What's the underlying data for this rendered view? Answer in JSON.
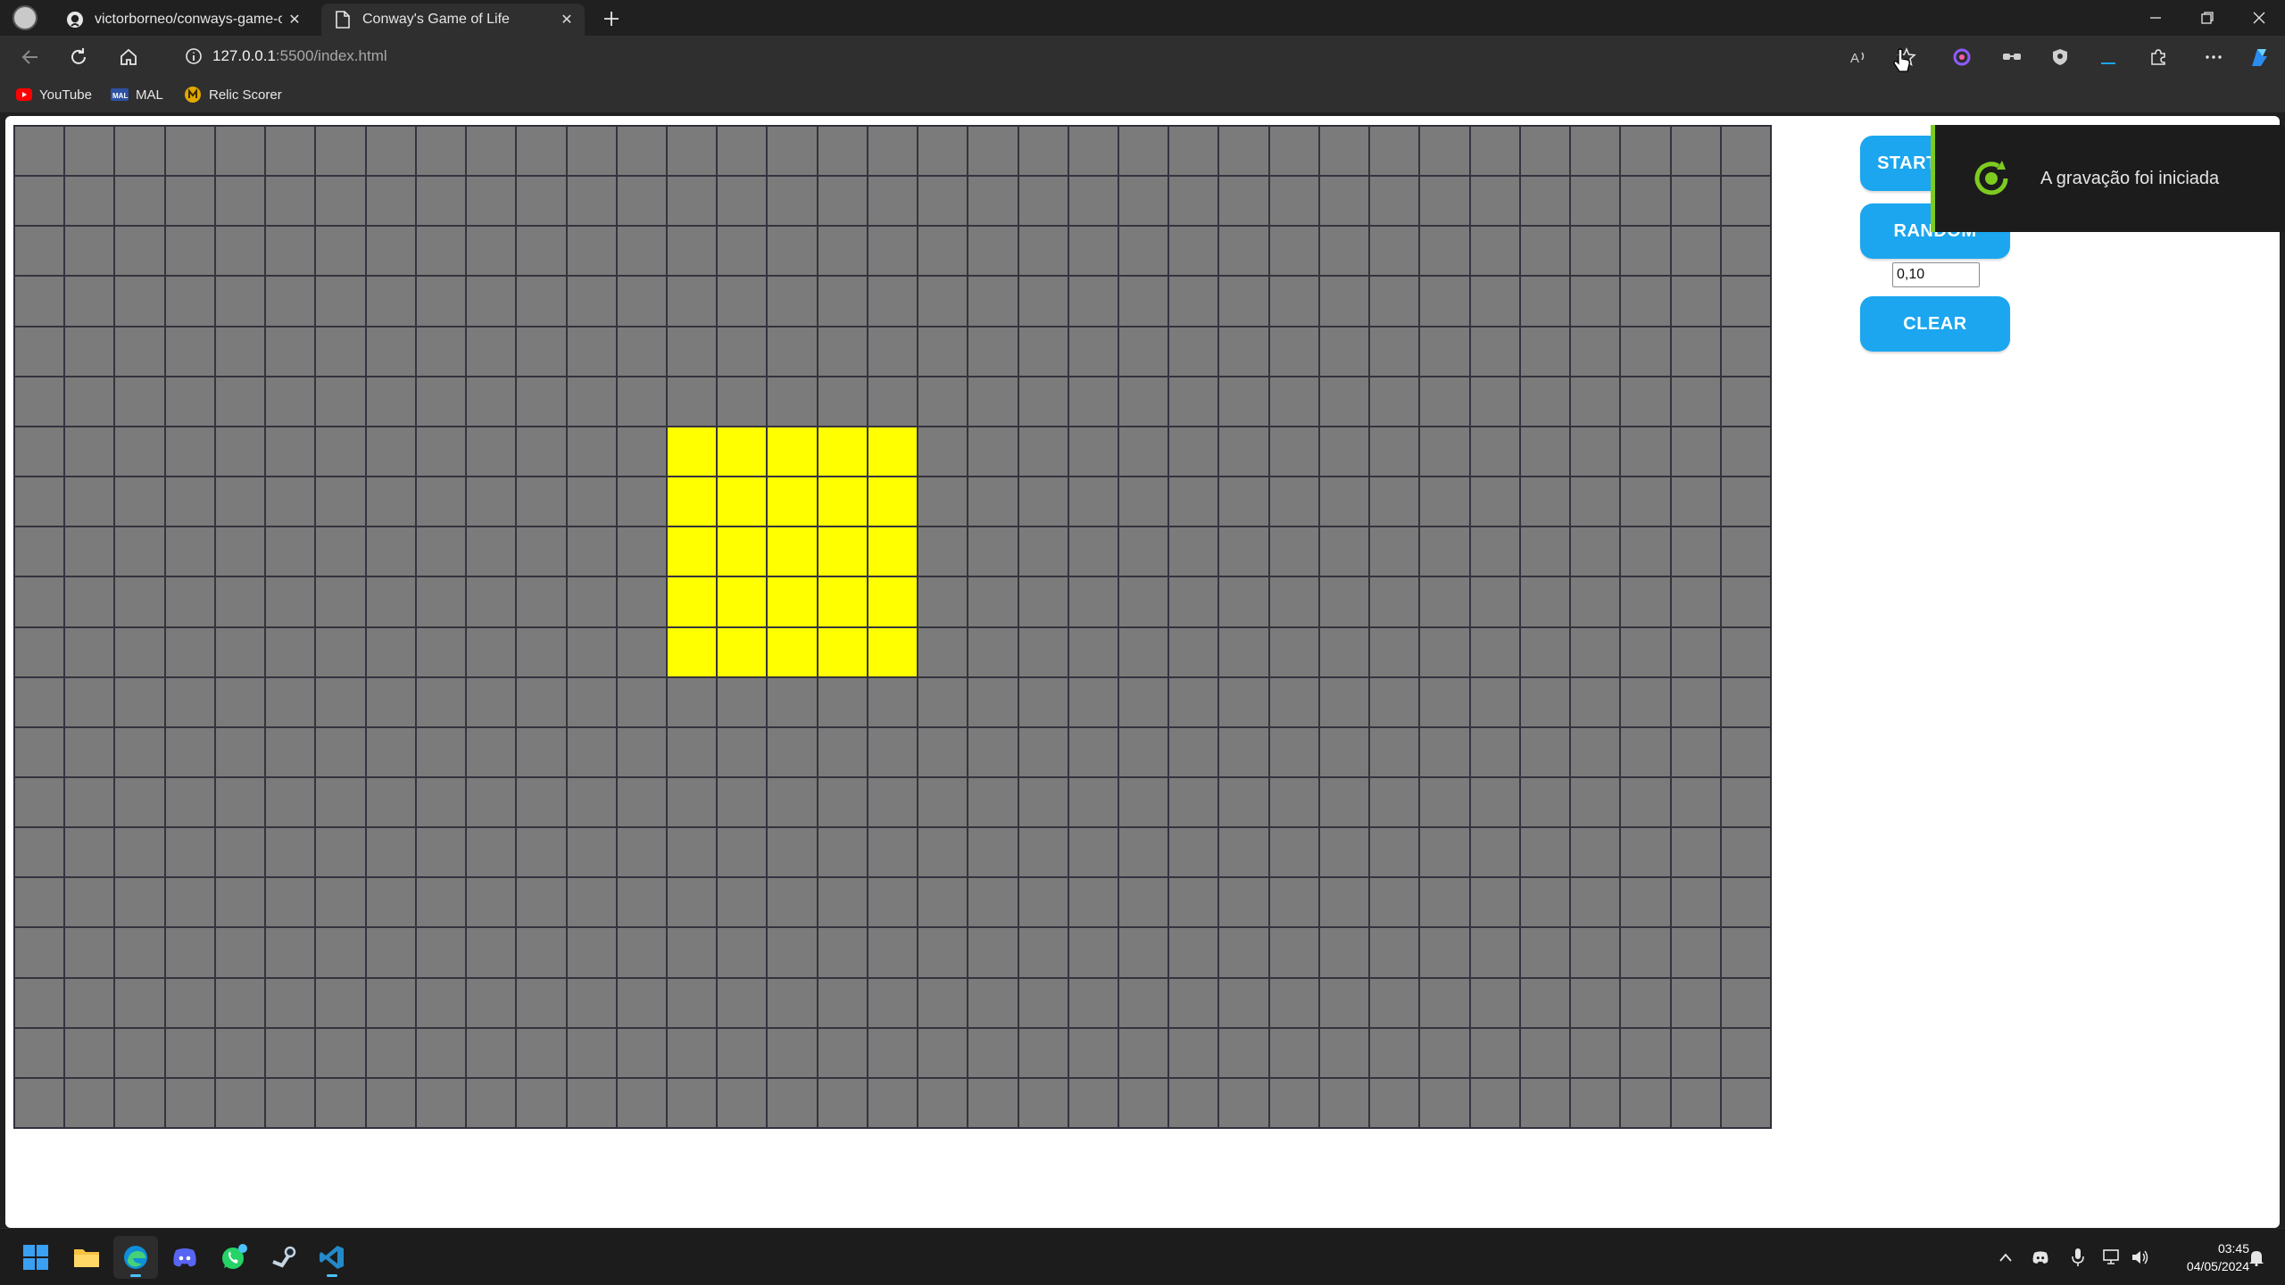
{
  "browser": {
    "tabs": [
      {
        "title": "victorborneo/conways-game-of",
        "icon": "github-icon"
      },
      {
        "title": "Conway's Game of Life",
        "icon": "page-icon"
      }
    ],
    "url_host": "127.0.0.1",
    "url_rest": ":5500/index.html",
    "bookmarks": [
      {
        "label": "YouTube",
        "icon": "youtube-icon"
      },
      {
        "label": "MAL",
        "icon": "mal-icon"
      },
      {
        "label": "Relic Scorer",
        "icon": "relic-scorer-icon"
      }
    ]
  },
  "game": {
    "grid": {
      "columns": 35,
      "rows": 20
    },
    "alive_cells": {
      "rows_from": 6,
      "rows_to": 10,
      "cols_from": 13,
      "cols_to": 17
    },
    "colors": {
      "dead": "#7b7b7b",
      "alive": "#ffff00",
      "grid_line": "#34343f",
      "button": "#1ba6ef"
    },
    "buttons": {
      "start": "START/STOP",
      "random": "RANDOM",
      "clear": "CLEAR"
    },
    "probability_value": "0,10"
  },
  "toast": {
    "text": "A gravação foi iniciada",
    "accent": "#7ecb20"
  },
  "taskbar": {
    "apps": [
      "windows-start",
      "file-explorer",
      "edge",
      "discord",
      "whatsapp",
      "steam",
      "vscode"
    ],
    "time": "03:45",
    "date": "04/05/2024"
  }
}
